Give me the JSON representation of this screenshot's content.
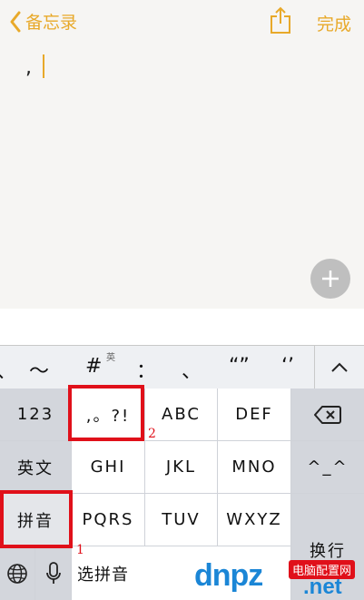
{
  "nav": {
    "back_label": "备忘录",
    "done_label": "完成"
  },
  "note": {
    "text": ","
  },
  "punct_row": {
    "keys": [
      "、",
      "～",
      "#",
      "：",
      "、",
      "“”",
      "‘’"
    ],
    "superscript": "英"
  },
  "keys": {
    "k123": "123",
    "punct": ",。?!",
    "abc": "ABC",
    "def": "DEF",
    "english": "英文",
    "ghi": "GHI",
    "jkl": "JKL",
    "mno": "MNO",
    "face": "^_^",
    "pinyin": "拼音",
    "pqrs": "PQRS",
    "tuv": "TUV",
    "wxyz": "WXYZ",
    "return": "换行",
    "select_pinyin": "选拼音"
  },
  "annotations": {
    "one": "1",
    "two": "2"
  },
  "watermark": {
    "main": "dnpz",
    "badge": "电脑配置网",
    "net": ".net"
  },
  "colors": {
    "accent": "#e8a92a",
    "highlight": "#e0101a",
    "watermark": "#1b86d6"
  }
}
